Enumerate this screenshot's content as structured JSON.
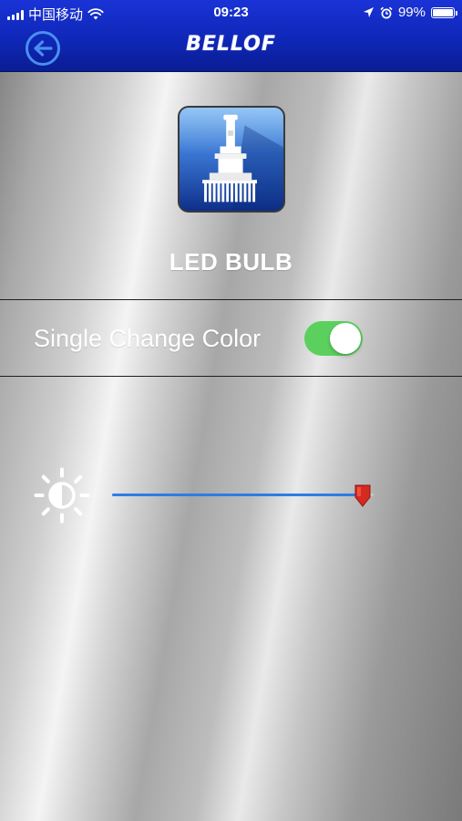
{
  "status_bar": {
    "carrier": "中国移动",
    "time": "09:23",
    "battery_percent": "99%",
    "battery_level": 0.99,
    "icons": [
      "signal-icon",
      "wifi-icon",
      "location-arrow-icon",
      "alarm-icon",
      "battery-icon"
    ]
  },
  "nav": {
    "brand": "BELLOF",
    "back_icon": "back-arrow-icon"
  },
  "product": {
    "icon": "led-bulb-icon",
    "title": "LED BULB"
  },
  "settings": {
    "single_change_color_label": "Single Change Color",
    "single_change_color_on": true
  },
  "brightness": {
    "icon": "brightness-icon",
    "value": 1.0
  },
  "colors": {
    "header_blue": "#0f27b8",
    "toggle_on": "#5cd05f",
    "slider_fill": "#2f7ce5",
    "slider_thumb": "#d42a1f"
  }
}
